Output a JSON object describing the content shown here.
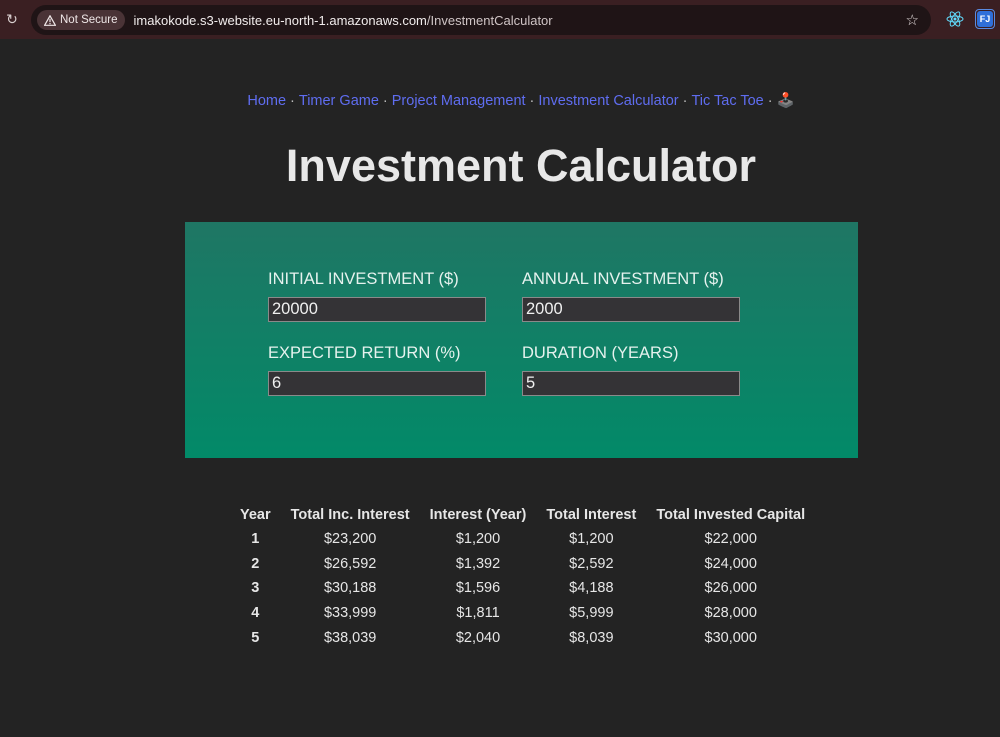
{
  "browser": {
    "security_label": "Not Secure",
    "url_host": "imakokode.s3-website.eu-north-1.amazonaws.com",
    "url_path": "/InvestmentCalculator"
  },
  "nav": {
    "links": [
      "Home",
      "Timer Game",
      "Project Management",
      "Investment Calculator",
      "Tic Tac Toe"
    ],
    "separator": "·",
    "trailing_emoji": "🕹️"
  },
  "page": {
    "title": "Investment Calculator"
  },
  "form": {
    "initial_investment": {
      "label": "INITIAL INVESTMENT ($)",
      "value": "20000"
    },
    "annual_investment": {
      "label": "ANNUAL INVESTMENT ($)",
      "value": "2000"
    },
    "expected_return": {
      "label": "EXPECTED RETURN (%)",
      "value": "6"
    },
    "duration": {
      "label": "DURATION (YEARS)",
      "value": "5"
    }
  },
  "results": {
    "headers": [
      "Year",
      "Total Inc. Interest",
      "Interest (Year)",
      "Total Interest",
      "Total Invested Capital"
    ],
    "rows": [
      [
        "1",
        "$23,200",
        "$1,200",
        "$1,200",
        "$22,000"
      ],
      [
        "2",
        "$26,592",
        "$1,392",
        "$2,592",
        "$24,000"
      ],
      [
        "3",
        "$30,188",
        "$1,596",
        "$4,188",
        "$26,000"
      ],
      [
        "4",
        "$33,999",
        "$1,811",
        "$5,999",
        "$28,000"
      ],
      [
        "5",
        "$38,039",
        "$2,040",
        "$8,039",
        "$30,000"
      ]
    ]
  },
  "icons": {
    "reload": "reload-icon",
    "warning": "warning-icon",
    "star": "bookmark-star-icon",
    "react_ext": "react-devtools-icon",
    "fj_ext_text": "FJ"
  },
  "colors": {
    "background": "#232323",
    "nav_link": "#5f6df0",
    "panel_top": "#1f7664",
    "panel_bottom": "#028a68"
  }
}
